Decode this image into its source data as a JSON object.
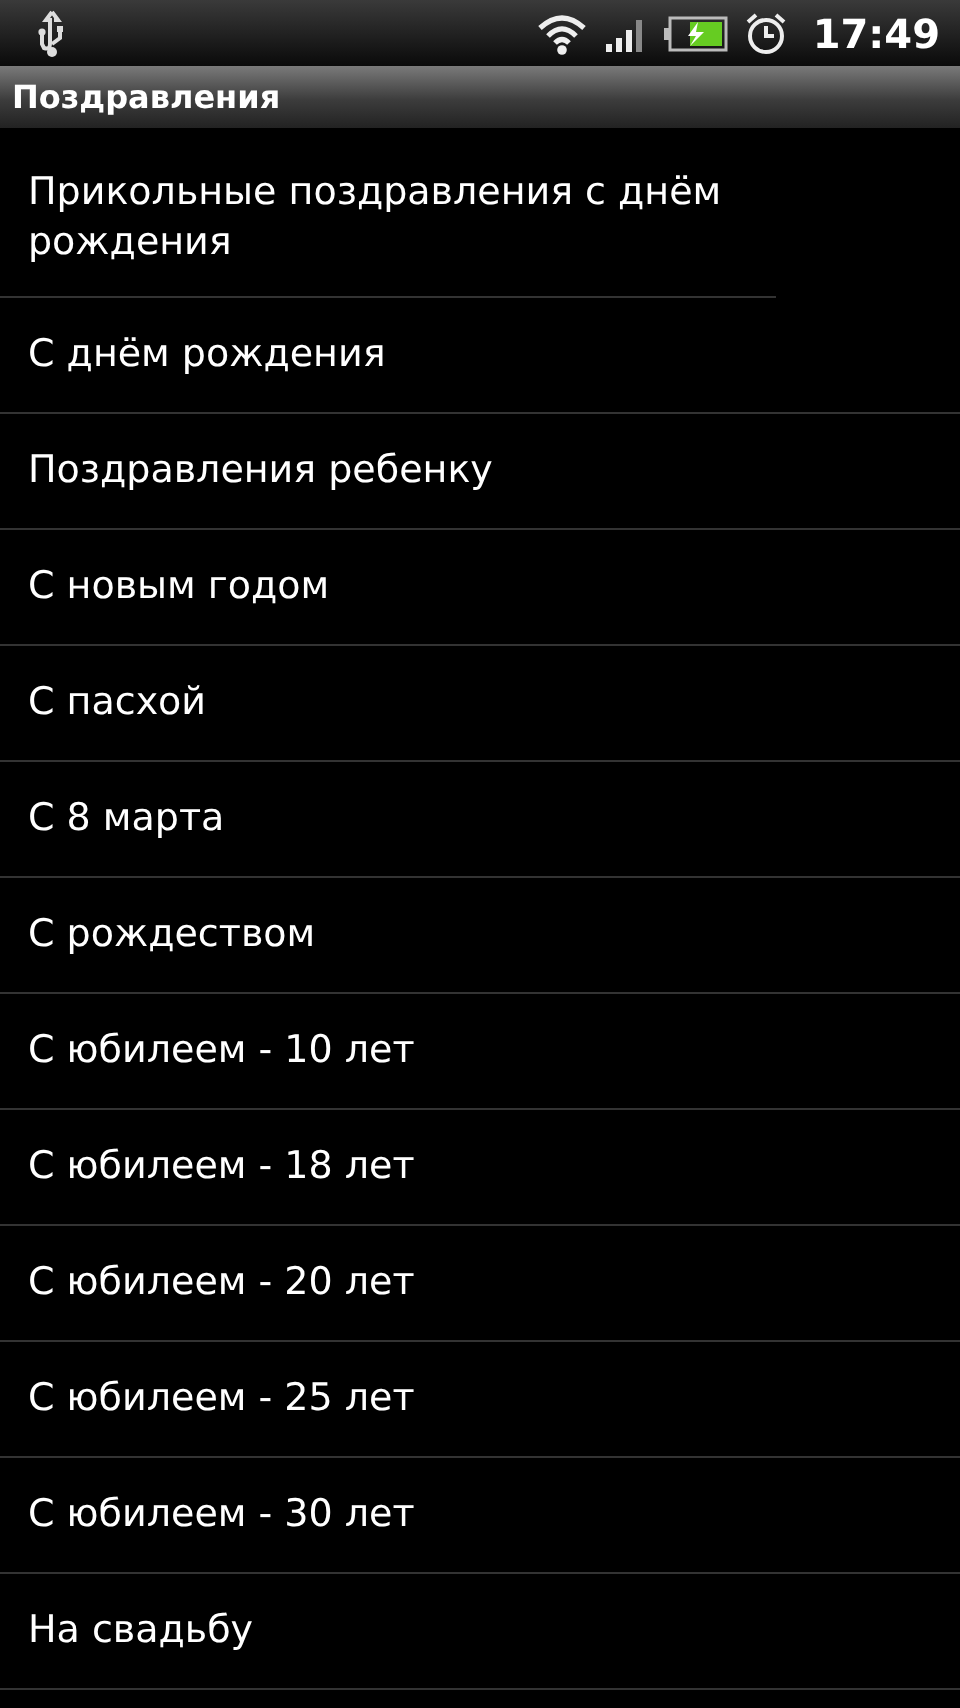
{
  "status_bar": {
    "time": "17:49"
  },
  "title": "Поздравления",
  "items": [
    "Прикольные поздравления с днём рождения",
    "С днём рождения",
    "Поздравления ребенку",
    "С новым годом",
    "С пасхой",
    "С 8 марта",
    "С рождеством",
    "С юбилеем - 10 лет",
    "С юбилеем - 18 лет",
    "С юбилеем - 20 лет",
    "С юбилеем - 25 лет",
    "С юбилеем - 30 лет",
    "На свадьбу"
  ]
}
